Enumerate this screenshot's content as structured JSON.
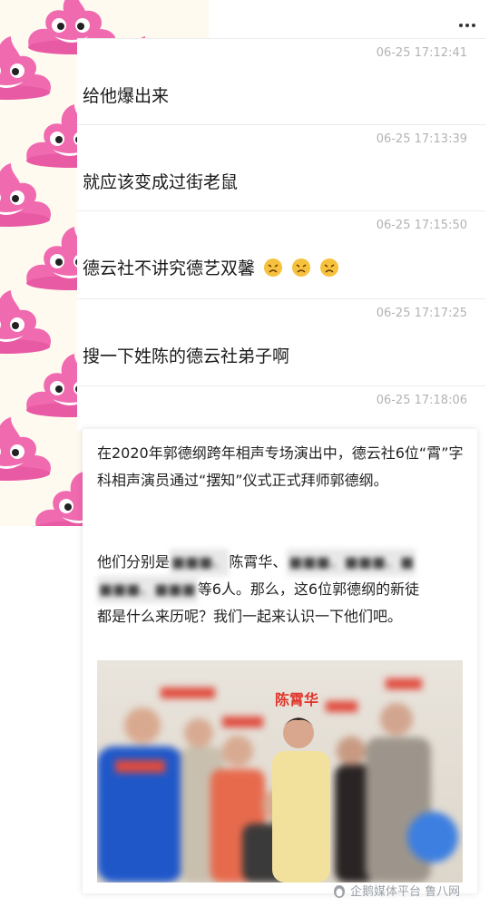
{
  "header": {
    "more_icon": "more-dots-icon"
  },
  "messages": [
    {
      "timestamp": "06-25 17:12:41",
      "text": "给他爆出来"
    },
    {
      "timestamp": "06-25 17:13:39",
      "text": "就应该变成过街老鼠"
    },
    {
      "timestamp": "06-25 17:15:50",
      "text": "德云社不讲究德艺双馨",
      "emojis": [
        "angry-face-icon",
        "angry-face-icon",
        "angry-face-icon"
      ]
    },
    {
      "timestamp": "06-25 17:17:25",
      "text": "搜一下姓陈的德云社弟子啊"
    },
    {
      "timestamp": "06-25 17:18:06",
      "text": ""
    }
  ],
  "article": {
    "paragraph1": "在2020年郭德纲跨年相声专场演出中，德云社6位“霄”字科相声演员通过“摆知”仪式正式拜师郭德纲。",
    "p2_line1_a": "他们分别是",
    "p2_line1_blur1": "■■■、",
    "p2_line1_b": "陈霄华、",
    "p2_line1_blur2": "■■■、■■■、■",
    "p2_line2_blur": "■■■、■■■",
    "p2_line2_a": "等6人。那么，这6位郭德纲的新徒",
    "p2_line3": "都是什么来历呢？我们一起来认识一下他们吧。",
    "photo_label": "陈霄华"
  },
  "watermark": {
    "text": "企鹅媒体平台 鲁八网"
  },
  "colors": {
    "timestamp": "#b3b3b3",
    "name_tag": "#e0352b",
    "poo_pink": "#f06ab0"
  }
}
